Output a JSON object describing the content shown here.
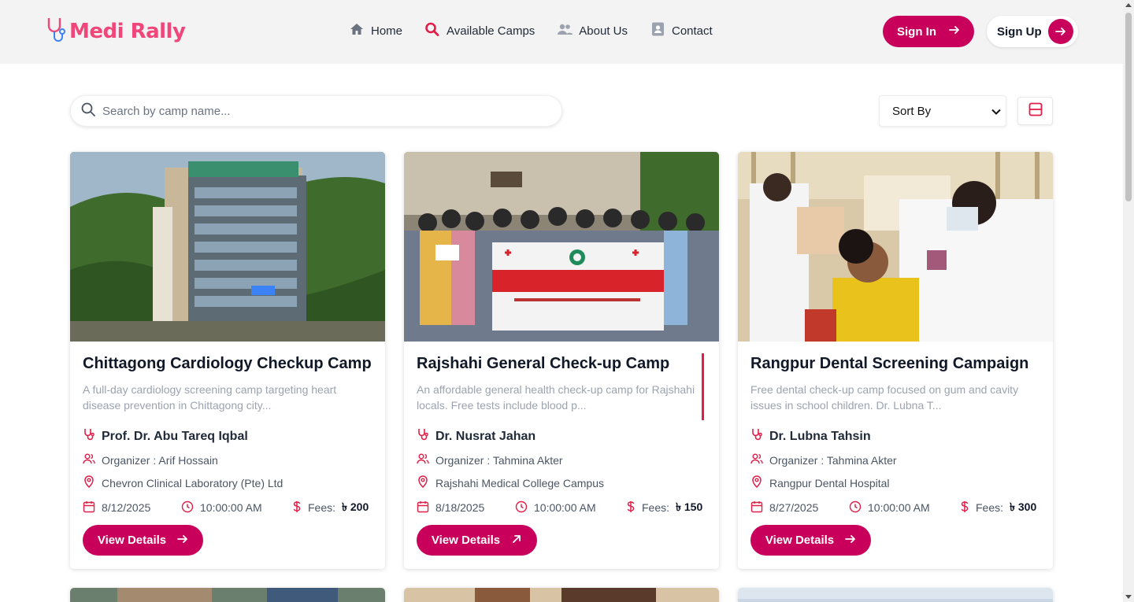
{
  "brand": {
    "name": "Medi Rally",
    "color": "#f0467a"
  },
  "nav": {
    "links": [
      {
        "label": "Home",
        "icon": "home-icon"
      },
      {
        "label": "Available Camps",
        "icon": "search-icon"
      },
      {
        "label": "About Us",
        "icon": "users-icon"
      },
      {
        "label": "Contact",
        "icon": "contact-card-icon"
      }
    ],
    "signin_label": "Sign In",
    "signup_label": "Sign Up"
  },
  "toolbar": {
    "search_placeholder": "Search by camp name...",
    "sort_label": "Sort By"
  },
  "colors": {
    "primary": "#c8005b",
    "accent": "#e11d48"
  },
  "cards": [
    {
      "title": "Chittagong Cardiology Checkup Camp",
      "description": "A full-day cardiology screening camp targeting heart disease prevention in Chittagong city...",
      "doctor": "Prof. Dr. Abu Tareq Iqbal",
      "organizer": "Organizer : Arif Hossain",
      "location": "Chevron Clinical Laboratory (Pte) Ltd",
      "date": "8/12/2025",
      "time": "10:00:00 AM",
      "fees_label": "Fees:",
      "fees_value": "৳ 200",
      "button": "View Details"
    },
    {
      "title": "Rajshahi General Check-up Camp",
      "description": "An affordable general health check-up camp for Rajshahi locals. Free tests include blood p...",
      "doctor": "Dr. Nusrat Jahan",
      "organizer": "Organizer : Tahmina Akter",
      "location": "Rajshahi Medical College Campus",
      "date": "8/18/2025",
      "time": "10:00:00 AM",
      "fees_label": "Fees:",
      "fees_value": "৳ 150",
      "button": "View Details"
    },
    {
      "title": "Rangpur Dental Screening Campaign",
      "description": "Free dental check-up camp focused on gum and cavity issues in school children. Dr. Lubna T...",
      "doctor": "Dr. Lubna Tahsin",
      "organizer": "Organizer : Tahmina Akter",
      "location": "Rangpur Dental Hospital",
      "date": "8/27/2025",
      "time": "10:00:00 AM",
      "fees_label": "Fees:",
      "fees_value": "৳ 300",
      "button": "View Details"
    }
  ]
}
